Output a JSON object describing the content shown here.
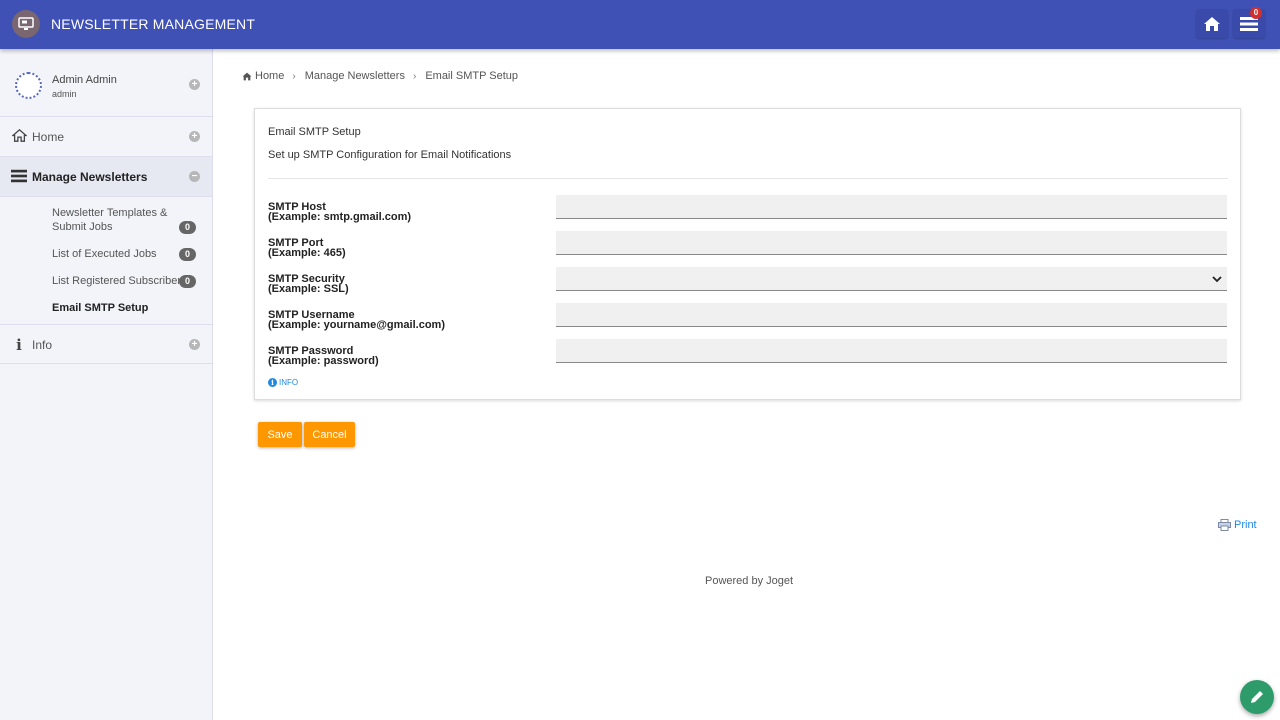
{
  "header": {
    "app_title": "NEWSLETTER MANAGEMENT",
    "inbox_count": "0",
    "colors": {
      "primary": "#3f51b5",
      "accent": "#ff9800",
      "fab": "#2e9b6a"
    }
  },
  "user": {
    "name": "Admin Admin",
    "role": "admin"
  },
  "nav": {
    "home": "Home",
    "manage": "Manage Newsletters",
    "info": "Info",
    "sub_items": [
      {
        "label_line1": "Newsletter Templates &",
        "label_line2": "Submit Jobs",
        "count": "0"
      },
      {
        "label": "List of Executed Jobs",
        "count": "0"
      },
      {
        "label": "List Registered Subscribers",
        "count": "0"
      },
      {
        "label": "Email SMTP Setup"
      }
    ]
  },
  "breadcrumb": [
    "Home",
    "Manage Newsletters",
    "Email SMTP Setup"
  ],
  "form": {
    "title": "Email SMTP Setup",
    "description": "Set up SMTP Configuration for Email Notifications",
    "fields": [
      {
        "label": "SMTP Host",
        "hint": "(Example: smtp.gmail.com)",
        "value": ""
      },
      {
        "label": "SMTP Port",
        "hint": "(Example: 465)",
        "value": ""
      },
      {
        "label": "SMTP Security",
        "hint": "(Example: SSL)",
        "value": ""
      },
      {
        "label": "SMTP Username",
        "hint": "(Example: yourname@gmail.com)",
        "value": ""
      },
      {
        "label": "SMTP Password",
        "hint": "(Example: password)",
        "value": ""
      }
    ],
    "info_label": "INFO"
  },
  "actions": {
    "save": "Save",
    "cancel": "Cancel"
  },
  "footer": {
    "print": "Print",
    "powered": "Powered by Joget"
  }
}
